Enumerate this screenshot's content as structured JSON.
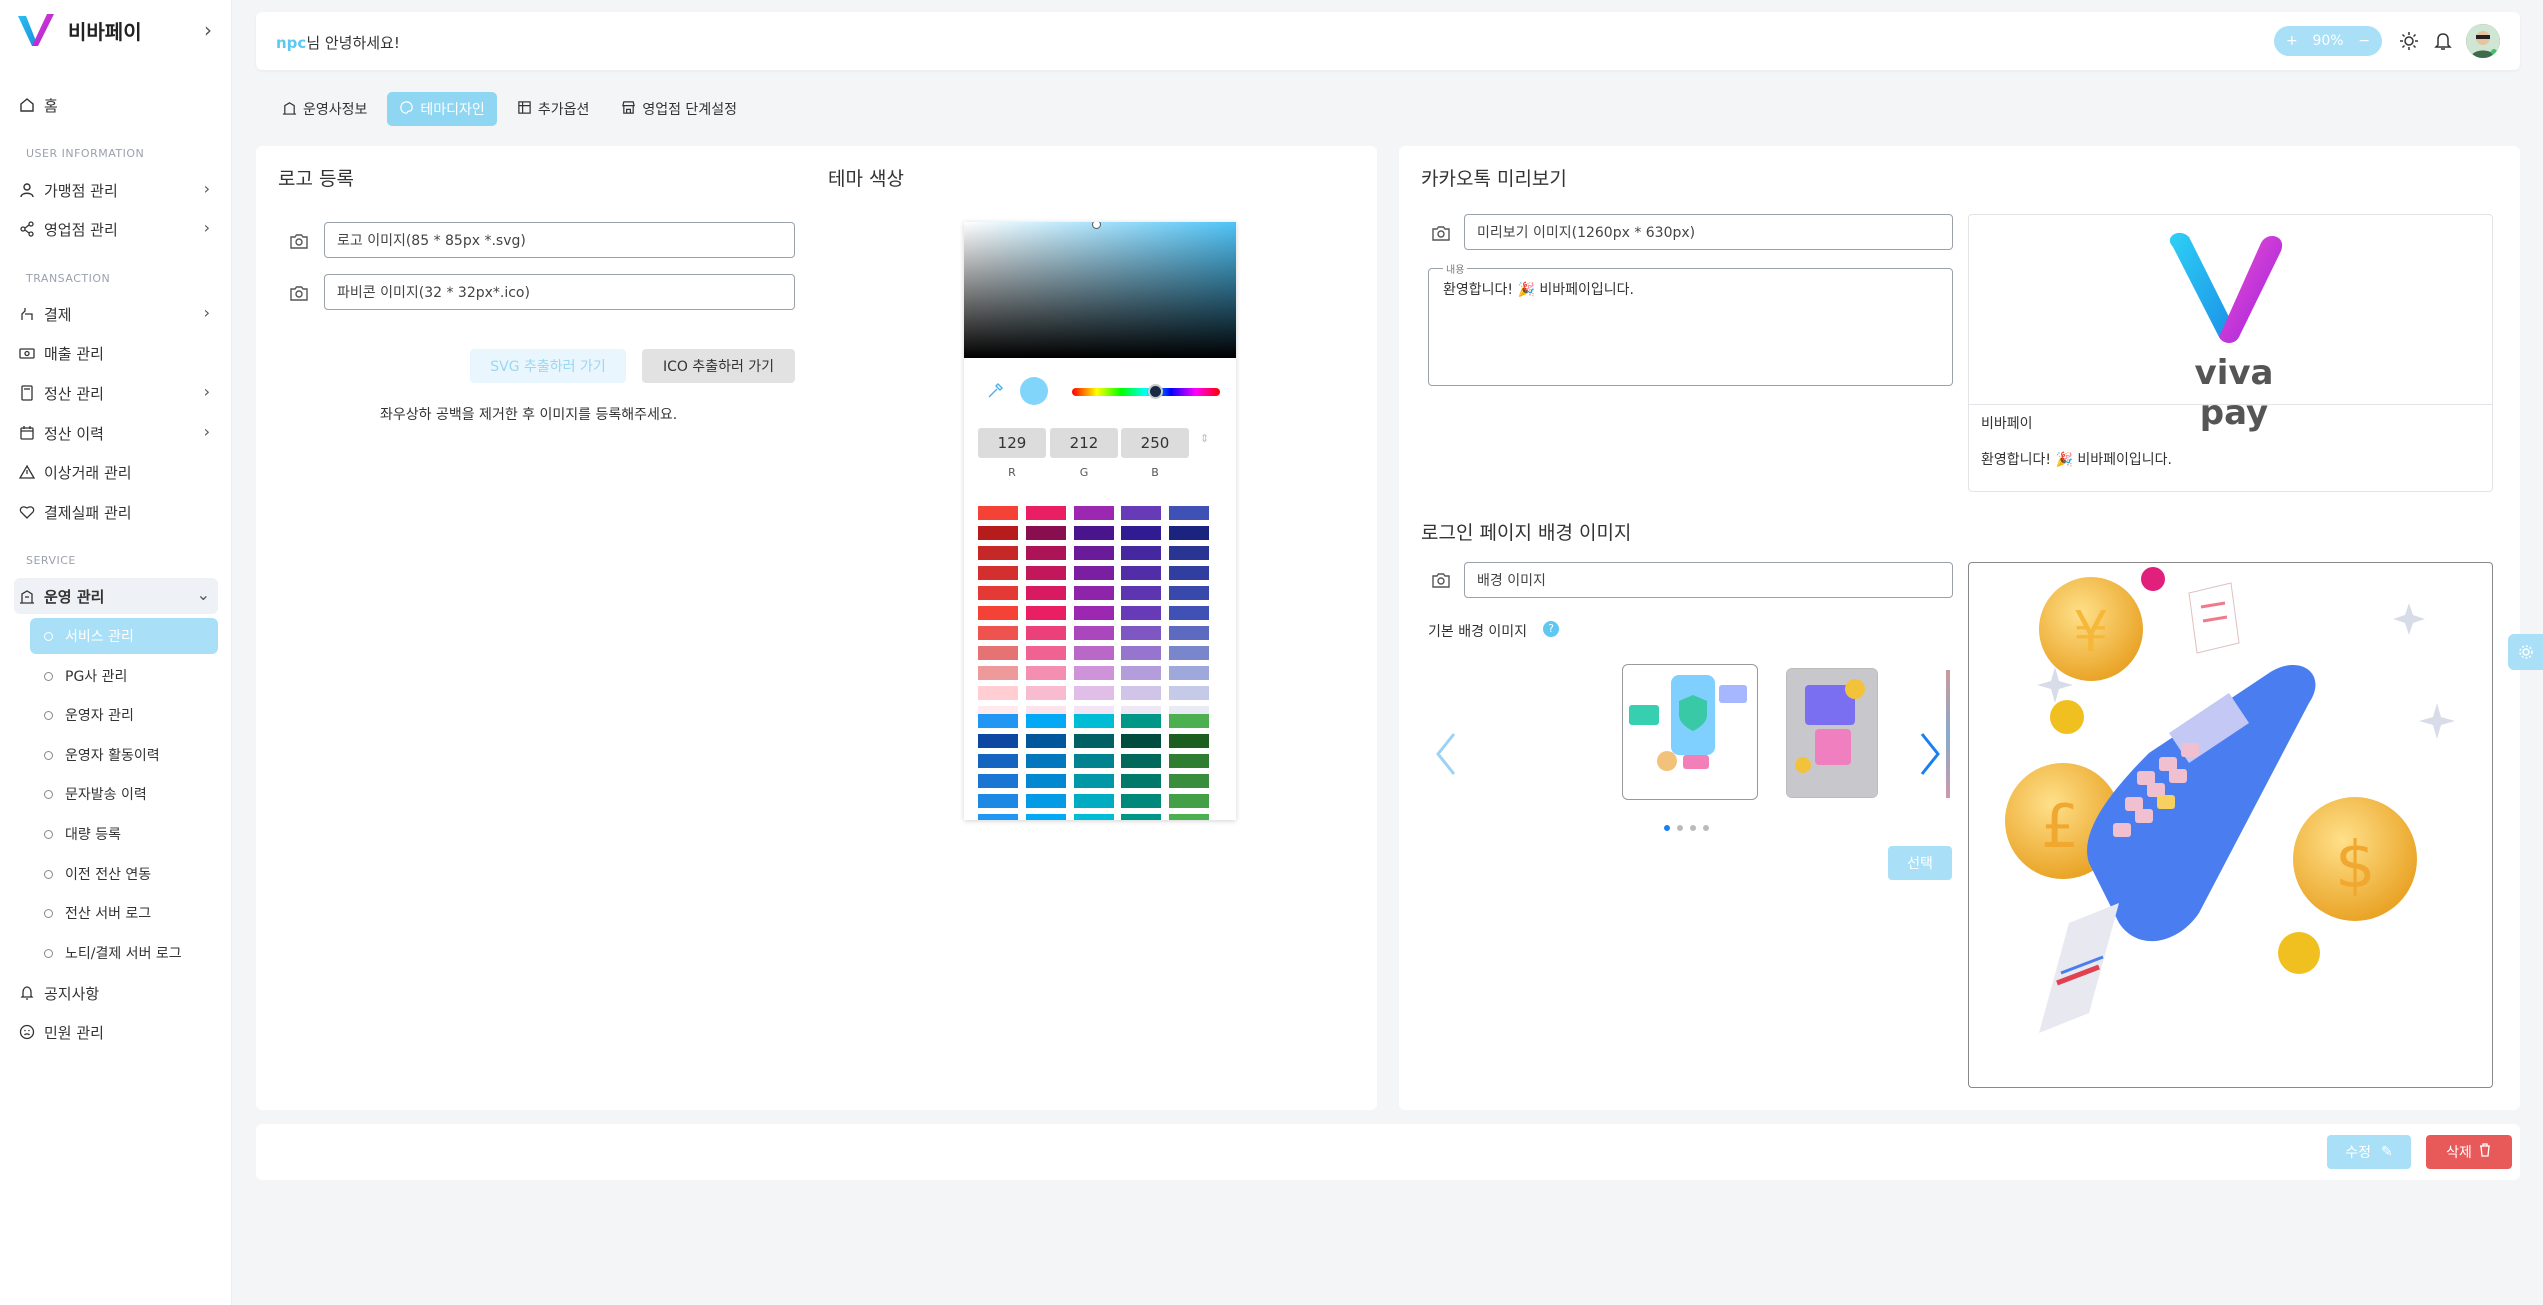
{
  "app": {
    "name": "비바페이"
  },
  "sidebar": {
    "home": "홈",
    "sections": {
      "user": "USER INFORMATION",
      "transaction": "TRANSACTION",
      "service": "SERVICE"
    },
    "user_items": [
      "가맹점 관리",
      "영업점 관리"
    ],
    "transaction_items": [
      "결제",
      "매출 관리",
      "정산 관리",
      "정산 이력",
      "이상거래 관리",
      "결제실패 관리"
    ],
    "service_group": "운영 관리",
    "service_sub": [
      "서비스 관리",
      "PG사 관리",
      "운영자 관리",
      "운영자 활동이력",
      "문자발송 이력",
      "대량 등록",
      "이전 전산 연동",
      "전산 서버 로그",
      "노티/결제 서버 로그"
    ],
    "bottom_items": [
      "공지사항",
      "민원 관리"
    ]
  },
  "topbar": {
    "user": "npc",
    "greeting": "님 안녕하세요!",
    "zoom": "90%"
  },
  "tabs": [
    "운영사정보",
    "테마디자인",
    "추가옵션",
    "영업점 단계설정"
  ],
  "logo_card": {
    "title": "로고 등록",
    "logo_placeholder": "로고 이미지(85 * 85px *.svg)",
    "favicon_placeholder": "파비콘 이미지(32 * 32px*.ico)",
    "svg_btn": "SVG 추출하러 가기",
    "ico_btn": "ICO 추출하러 가기",
    "notice": "좌우상하 공백을 제거한 후 이미지를 등록해주세요."
  },
  "theme": {
    "title": "테마 색상",
    "r": "129",
    "g": "212",
    "b": "250",
    "r_label": "R",
    "g_label": "G",
    "b_label": "B",
    "color": "#81D4FA"
  },
  "kakao": {
    "title": "카카오톡 미리보기",
    "image_placeholder": "미리보기 이미지(1260px * 630px)",
    "content_label": "내용",
    "content": "환영합니다! 🎉 비바페이입니다.",
    "preview_name": "비바페이",
    "preview_text": "환영합니다! 🎉 비바페이입니다.",
    "brand_text": "viva pay"
  },
  "login_bg": {
    "title": "로그인 페이지 배경 이미지",
    "bg_placeholder": "배경 이미지",
    "default_label": "기본 배경 이미지",
    "select_btn": "선택"
  },
  "actions": {
    "edit": "수정",
    "delete": "삭제"
  },
  "colors": {
    "accent": "#81D4FA",
    "danger": "#E85A5A"
  }
}
